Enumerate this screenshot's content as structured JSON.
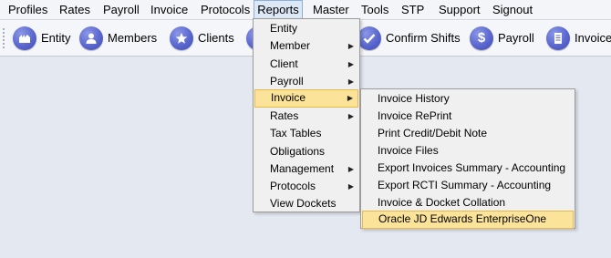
{
  "menubar": {
    "items": [
      "Profiles",
      "Rates",
      "Payroll",
      "Invoice",
      "Protocols",
      "Reports",
      "Master",
      "Tools",
      "STP",
      "Support",
      "Signout"
    ]
  },
  "toolbar": {
    "buttons": [
      {
        "label": "Entity",
        "icon": "building-icon"
      },
      {
        "label": "Members",
        "icon": "user-icon"
      },
      {
        "label": "Clients",
        "icon": "star-icon"
      },
      {
        "label": "",
        "icon": "partial-icon"
      },
      {
        "label": "Confirm Shifts",
        "icon": "check-icon"
      },
      {
        "label": "Payroll",
        "icon": "dollar-icon"
      },
      {
        "label": "Invoice",
        "icon": "document-icon"
      }
    ]
  },
  "reports_menu": {
    "items": [
      {
        "label": "Entity",
        "submenu": false
      },
      {
        "label": "Member",
        "submenu": true
      },
      {
        "label": "Client",
        "submenu": true
      },
      {
        "label": "Payroll",
        "submenu": true
      },
      {
        "label": "Invoice",
        "submenu": true,
        "highlighted": true
      },
      {
        "label": "Rates",
        "submenu": true
      },
      {
        "label": "Tax Tables",
        "submenu": false
      },
      {
        "label": "Obligations",
        "submenu": false
      },
      {
        "label": "Management",
        "submenu": true
      },
      {
        "label": "Protocols",
        "submenu": true
      },
      {
        "label": "View Dockets",
        "submenu": false
      }
    ]
  },
  "invoice_submenu": {
    "items": [
      {
        "label": "Invoice History"
      },
      {
        "label": "Invoice RePrint"
      },
      {
        "label": "Print Credit/Debit Note"
      },
      {
        "label": "Invoice Files"
      },
      {
        "label": "Export Invoices Summary - Accounting"
      },
      {
        "label": "Export RCTI Summary - Accounting"
      },
      {
        "label": "Invoice & Docket Collation"
      },
      {
        "label": "Oracle JD Edwards EnterpriseOne",
        "highlighted": true
      }
    ]
  },
  "colors": {
    "highlight": "#fbe39a",
    "icon": "#5a67cf",
    "background": "#e4e8f1"
  }
}
